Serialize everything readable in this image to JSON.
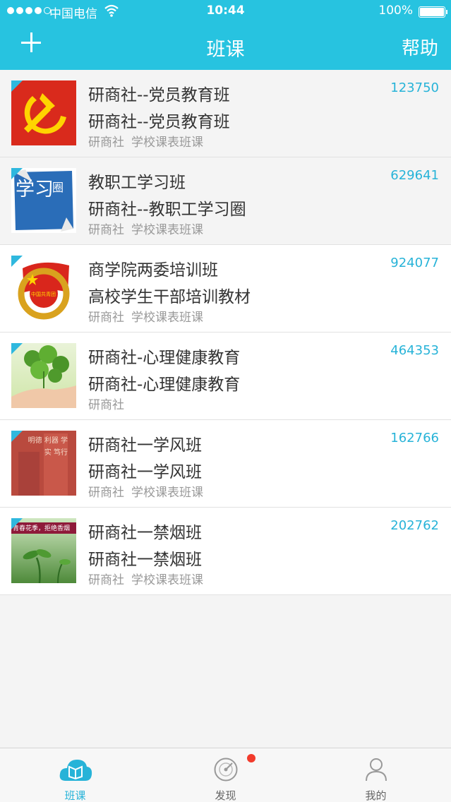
{
  "status_bar": {
    "carrier": "中国电信",
    "time": "10:44",
    "battery": "100%"
  },
  "header": {
    "add_icon": "plus-icon",
    "title": "班课",
    "help_label": "帮助"
  },
  "courses": [
    {
      "name": "研商社--党员教育班",
      "subtitle": "研商社--党员教育班",
      "org": "研商社",
      "tag": "学校课表班课",
      "code": "123750"
    },
    {
      "name": "教职工学习班",
      "subtitle": "研商社--教职工学习圈",
      "org": "研商社",
      "tag": "学校课表班课",
      "code": "629641"
    },
    {
      "name": "商学院两委培训班",
      "subtitle": "高校学生干部培训教材",
      "org": "研商社",
      "tag": "学校课表班课",
      "code": "924077"
    },
    {
      "name": "研商社-心理健康教育",
      "subtitle": "研商社-心理健康教育",
      "org": "研商社",
      "tag": "",
      "code": "464353"
    },
    {
      "name": "研商社一学风班",
      "subtitle": "研商社一学风班",
      "org": "研商社",
      "tag": "学校课表班课",
      "code": "162766"
    },
    {
      "name": "研商社一禁烟班",
      "subtitle": "研商社一禁烟班",
      "org": "研商社",
      "tag": "学校课表班课",
      "code": "202762"
    }
  ],
  "thumb_text": {
    "study_big": "学习",
    "study_small": "圈",
    "league_emblem": "中国共青团",
    "calligraphy": "明德 利器 学实 笃行",
    "smoking_banner": "青春花季，拒绝香烟"
  },
  "tabs": [
    {
      "label": "班课",
      "icon": "class-book-icon",
      "active": true
    },
    {
      "label": "发现",
      "icon": "discover-radar-icon",
      "active": false,
      "badge": true
    },
    {
      "label": "我的",
      "icon": "profile-person-icon",
      "active": false
    }
  ],
  "colors": {
    "header": "#27c3e0",
    "accent": "#27b3d8",
    "badge": "#f23b2c"
  }
}
